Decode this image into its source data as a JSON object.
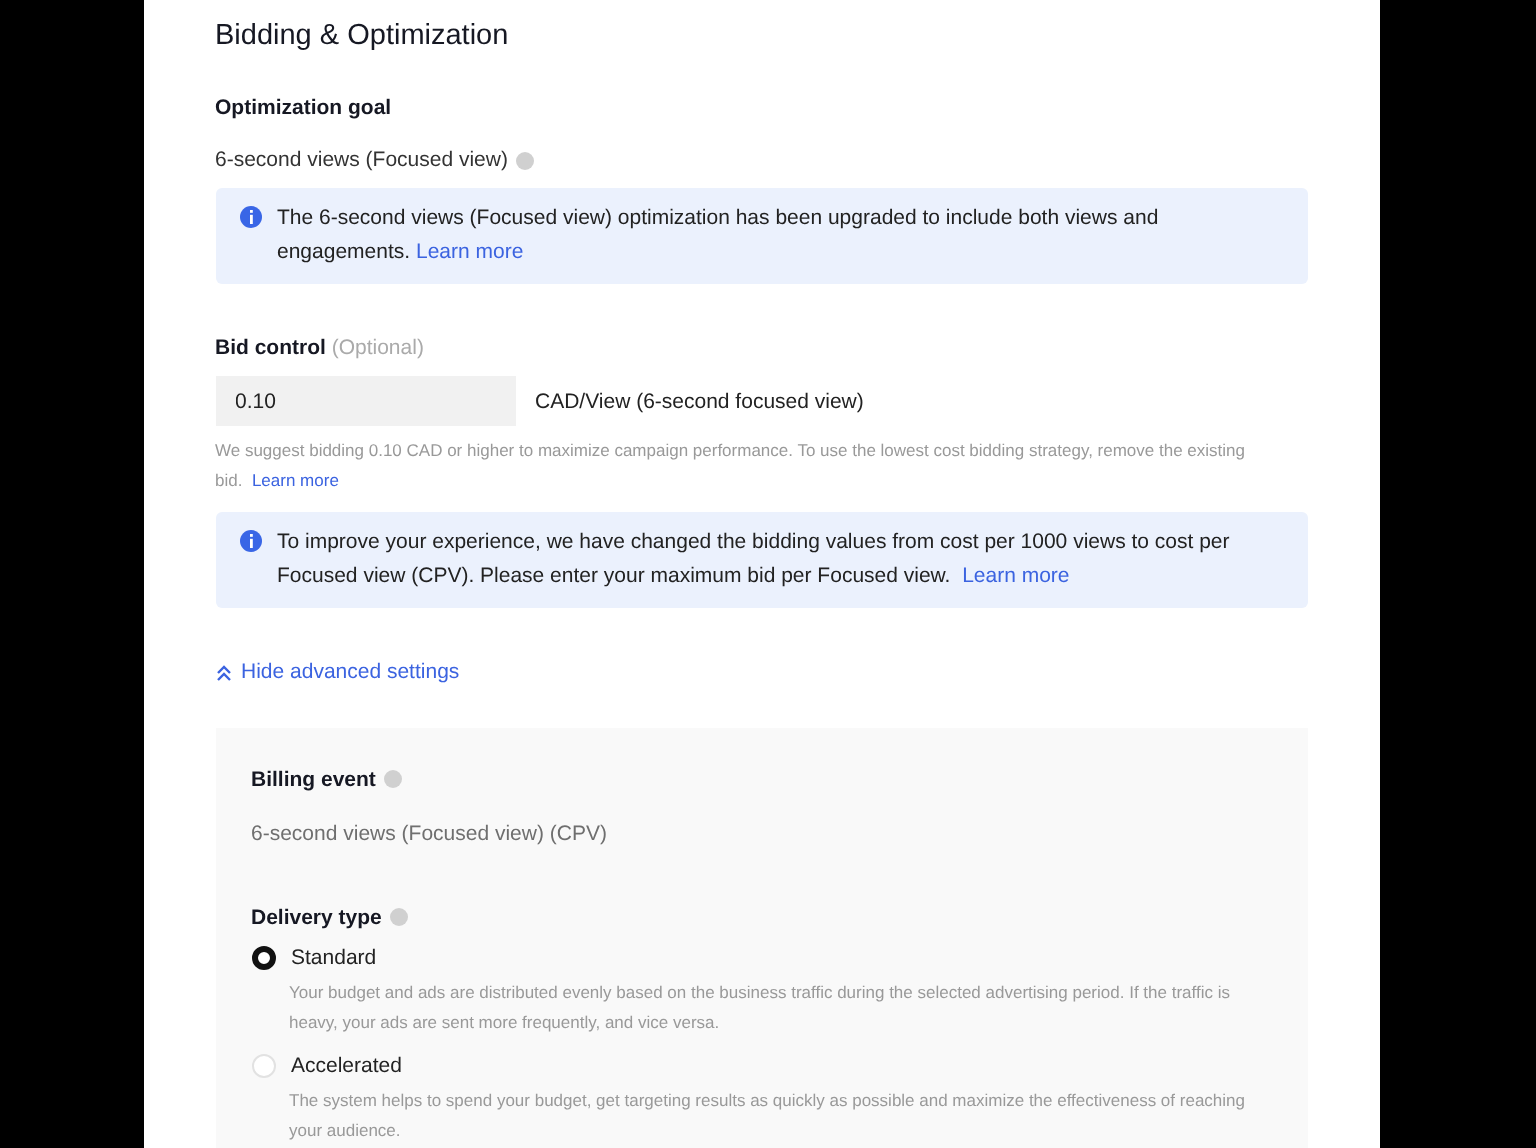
{
  "title": "Bidding & Optimization",
  "optimization_goal": {
    "label": "Optimization goal",
    "value": "6-second views (Focused view)"
  },
  "goal_notice": {
    "text": "The 6-second views (Focused view) optimization has been upgraded to include both views and engagements.",
    "link": "Learn more"
  },
  "bid_control": {
    "label": "Bid control",
    "optional": "(Optional)",
    "value": "0.10",
    "unit": "CAD/View (6-second focused view)",
    "hint": "We suggest bidding 0.10 CAD or higher to maximize campaign performance. To use the lowest cost bidding strategy, remove the existing bid.",
    "hint_link": "Learn more"
  },
  "bid_notice": {
    "text": "To improve your experience, we have changed the bidding values from cost per 1000 views to cost per Focused view (CPV). Please enter your maximum bid per Focused view.",
    "link": "Learn more"
  },
  "advanced_toggle": {
    "label": "Hide advanced settings",
    "expanded": true
  },
  "billing_event": {
    "label": "Billing event",
    "value": "6-second views (Focused view) (CPV)"
  },
  "delivery_type": {
    "label": "Delivery type",
    "options": [
      {
        "label": "Standard",
        "selected": true,
        "description": "Your budget and ads are distributed evenly based on the business traffic during the selected advertising period. If the traffic is heavy, your ads are sent more frequently, and vice versa."
      },
      {
        "label": "Accelerated",
        "selected": false,
        "description": "The system helps to spend your budget, get targeting results as quickly as possible and maximize the effectiveness of reaching your audience."
      }
    ]
  }
}
